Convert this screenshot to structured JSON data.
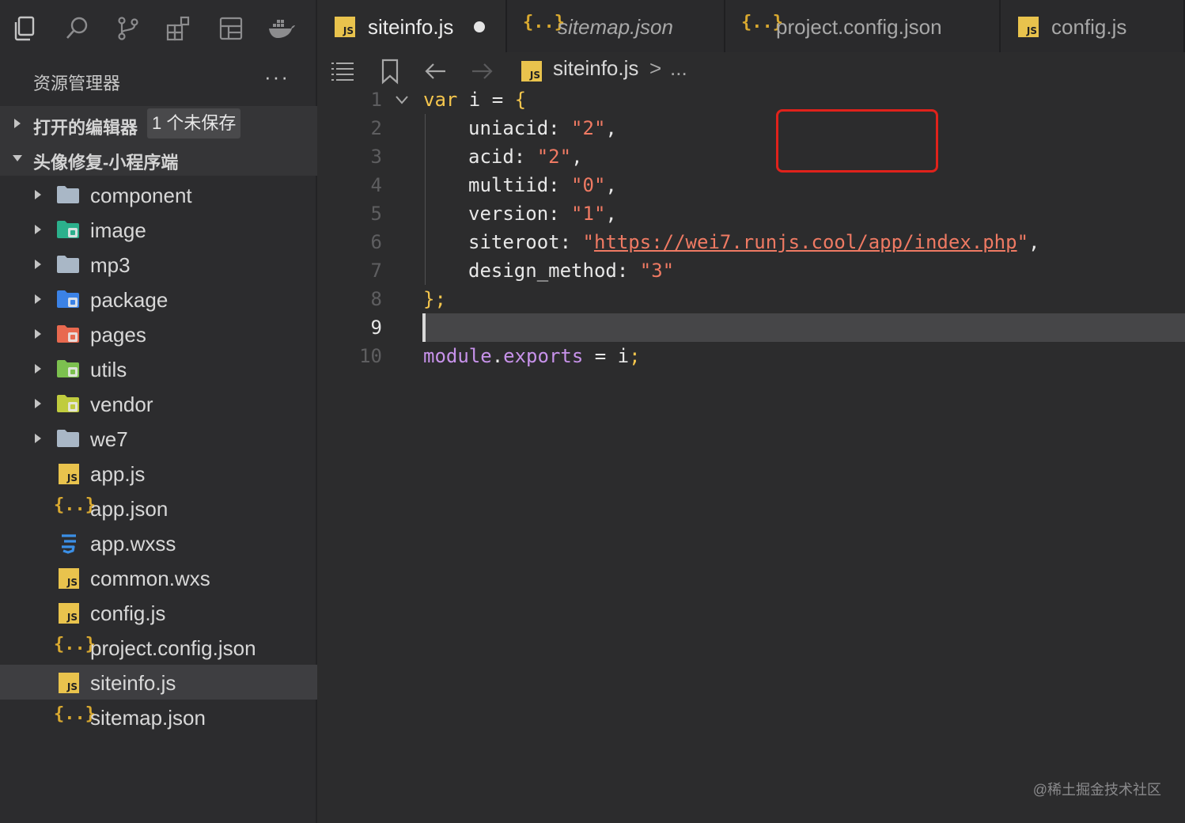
{
  "activity_bar": {
    "icons": [
      "explorer-icon",
      "search-icon",
      "source-control-icon",
      "extensions-icon",
      "layout-icon",
      "docker-icon"
    ]
  },
  "explorer": {
    "title": "资源管理器",
    "more": "···",
    "open_editors": {
      "label": "打开的编辑器",
      "badge": "1 个未保存"
    },
    "project": {
      "label": "头像修复-小程序端"
    },
    "tree": [
      {
        "label": "component",
        "kind": "folder",
        "icon": "folder-icon",
        "color": "#a9b7c6"
      },
      {
        "label": "image",
        "kind": "folder",
        "icon": "folder-image-icon",
        "color": "#2bb08c"
      },
      {
        "label": "mp3",
        "kind": "folder",
        "icon": "folder-icon",
        "color": "#a9b7c6"
      },
      {
        "label": "package",
        "kind": "folder",
        "icon": "folder-package-icon",
        "color": "#3b82e6"
      },
      {
        "label": "pages",
        "kind": "folder",
        "icon": "folder-pages-icon",
        "color": "#e8694f"
      },
      {
        "label": "utils",
        "kind": "folder",
        "icon": "folder-utils-icon",
        "color": "#7cc04f"
      },
      {
        "label": "vendor",
        "kind": "folder",
        "icon": "folder-vendor-icon",
        "color": "#c0cc3e"
      },
      {
        "label": "we7",
        "kind": "folder",
        "icon": "folder-icon",
        "color": "#a9b7c6"
      },
      {
        "label": "app.js",
        "kind": "js",
        "icon": "js-file-icon"
      },
      {
        "label": "app.json",
        "kind": "json",
        "icon": "json-file-icon"
      },
      {
        "label": "app.wxss",
        "kind": "css",
        "icon": "css-file-icon"
      },
      {
        "label": "common.wxs",
        "kind": "js",
        "icon": "js-file-icon"
      },
      {
        "label": "config.js",
        "kind": "js",
        "icon": "js-file-icon"
      },
      {
        "label": "project.config.json",
        "kind": "json",
        "icon": "json-file-icon"
      },
      {
        "label": "siteinfo.js",
        "kind": "js",
        "icon": "js-file-icon",
        "selected": true
      },
      {
        "label": "sitemap.json",
        "kind": "json",
        "icon": "json-file-icon"
      }
    ]
  },
  "tabs": [
    {
      "label": "siteinfo.js",
      "kind": "js",
      "active": true,
      "dirty": true,
      "italic": false
    },
    {
      "label": "sitemap.json",
      "kind": "json",
      "active": false,
      "dirty": false,
      "italic": true
    },
    {
      "label": "project.config.json",
      "kind": "json",
      "active": false,
      "dirty": false,
      "italic": false
    },
    {
      "label": "config.js",
      "kind": "js",
      "active": false,
      "dirty": false,
      "italic": false
    }
  ],
  "breadcrumb": {
    "file": "siteinfo.js",
    "separator": ">",
    "ellipsis": "..."
  },
  "code": {
    "line_numbers": [
      "1",
      "2",
      "3",
      "4",
      "5",
      "6",
      "7",
      "8",
      "9",
      "10"
    ],
    "current_line": "9",
    "lines": [
      {
        "n": "1",
        "tokens": [
          {
            "t": "var",
            "c": "kw"
          },
          {
            "t": " i ",
            "c": "prop"
          },
          {
            "t": "=",
            "c": "punc"
          },
          {
            "t": " {",
            "c": "kw"
          }
        ]
      },
      {
        "n": "2",
        "tokens": [
          {
            "t": "uniacid: ",
            "c": "prop"
          },
          {
            "t": "\"2\"",
            "c": "str"
          },
          {
            "t": ",",
            "c": "punc"
          }
        ]
      },
      {
        "n": "3",
        "tokens": [
          {
            "t": "acid: ",
            "c": "prop"
          },
          {
            "t": "\"2\"",
            "c": "str"
          },
          {
            "t": ",",
            "c": "punc"
          }
        ]
      },
      {
        "n": "4",
        "tokens": [
          {
            "t": "multiid: ",
            "c": "prop"
          },
          {
            "t": "\"0\"",
            "c": "str"
          },
          {
            "t": ",",
            "c": "punc"
          }
        ]
      },
      {
        "n": "5",
        "tokens": [
          {
            "t": "version: ",
            "c": "prop"
          },
          {
            "t": "\"1\"",
            "c": "str"
          },
          {
            "t": ",",
            "c": "punc"
          }
        ]
      },
      {
        "n": "6",
        "tokens": [
          {
            "t": "siteroot: ",
            "c": "prop"
          },
          {
            "t": "\"",
            "c": "str"
          },
          {
            "t": "https://wei7.runjs.cool/app/index.php",
            "c": "url"
          },
          {
            "t": "\"",
            "c": "str"
          },
          {
            "t": ",",
            "c": "punc"
          }
        ]
      },
      {
        "n": "7",
        "tokens": [
          {
            "t": "design_method: ",
            "c": "prop"
          },
          {
            "t": "\"3\"",
            "c": "str"
          }
        ]
      },
      {
        "n": "8",
        "tokens": [
          {
            "t": "};",
            "c": "kw"
          }
        ]
      },
      {
        "n": "9",
        "tokens": []
      },
      {
        "n": "10",
        "tokens": [
          {
            "t": "module",
            "c": "kwp"
          },
          {
            "t": ".",
            "c": "punc"
          },
          {
            "t": "exports",
            "c": "kwp"
          },
          {
            "t": " = ",
            "c": "prop"
          },
          {
            "t": "i",
            "c": "prop"
          },
          {
            "t": ";",
            "c": "kw"
          }
        ]
      }
    ]
  },
  "watermark": "@稀土掘金技术社区",
  "colors": {
    "keyword": "#f5c64d",
    "string": "#ef7a63",
    "module": "#c792ea",
    "highlight_box": "#e0221b",
    "js_badge": "#e9c34d"
  }
}
